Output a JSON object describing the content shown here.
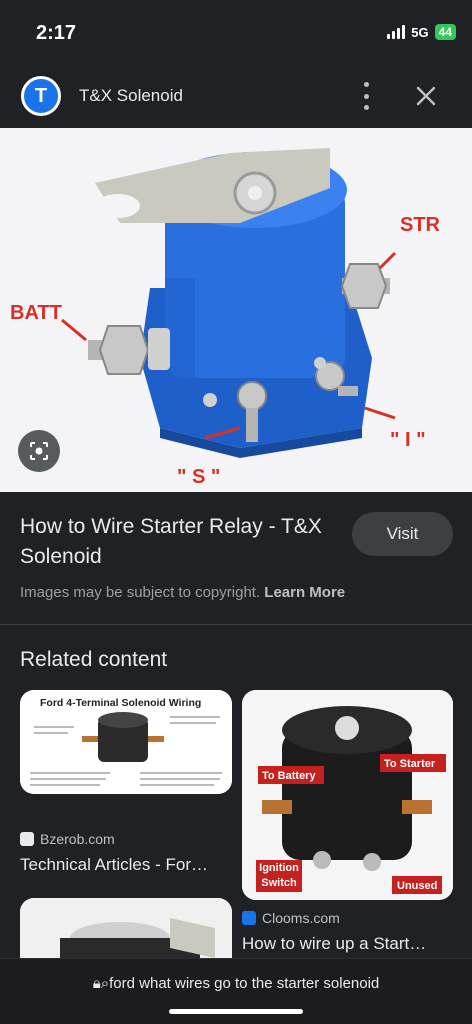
{
  "status": {
    "time": "2:17",
    "network": "5G",
    "battery": "44"
  },
  "header": {
    "logo_letter": "T",
    "title": "T&X Solenoid"
  },
  "hero": {
    "labels": {
      "str": "STR",
      "batt": "BATT",
      "s": "\" S \"",
      "i": "\" I \""
    }
  },
  "result": {
    "title": "How to Wire Starter Relay - T&X Solenoid",
    "visit_label": "Visit",
    "copyright_text": "Images may be subject to copyright.",
    "learn_more": "Learn More"
  },
  "related": {
    "heading": "Related content",
    "cards": [
      {
        "image_title": "Ford 4-Terminal Solenoid Wiring",
        "source": "Bzerob.com",
        "title": "Technical Articles - For…",
        "fav_color": "#e8eaed"
      },
      {
        "image_labels": {
          "battery": "To Battery",
          "starter": "To Starter",
          "ignition": "Ignition Switch",
          "unused": "Unused"
        },
        "source": "Clooms.com",
        "title": "How to wire up a Start…",
        "fav_color": "#1a73e8"
      }
    ]
  },
  "bottom": {
    "url": "ford what wires go to the starter solenoid"
  },
  "colors": {
    "accent": "#1a73e8",
    "label_red": "#d93025",
    "background": "#202124"
  }
}
